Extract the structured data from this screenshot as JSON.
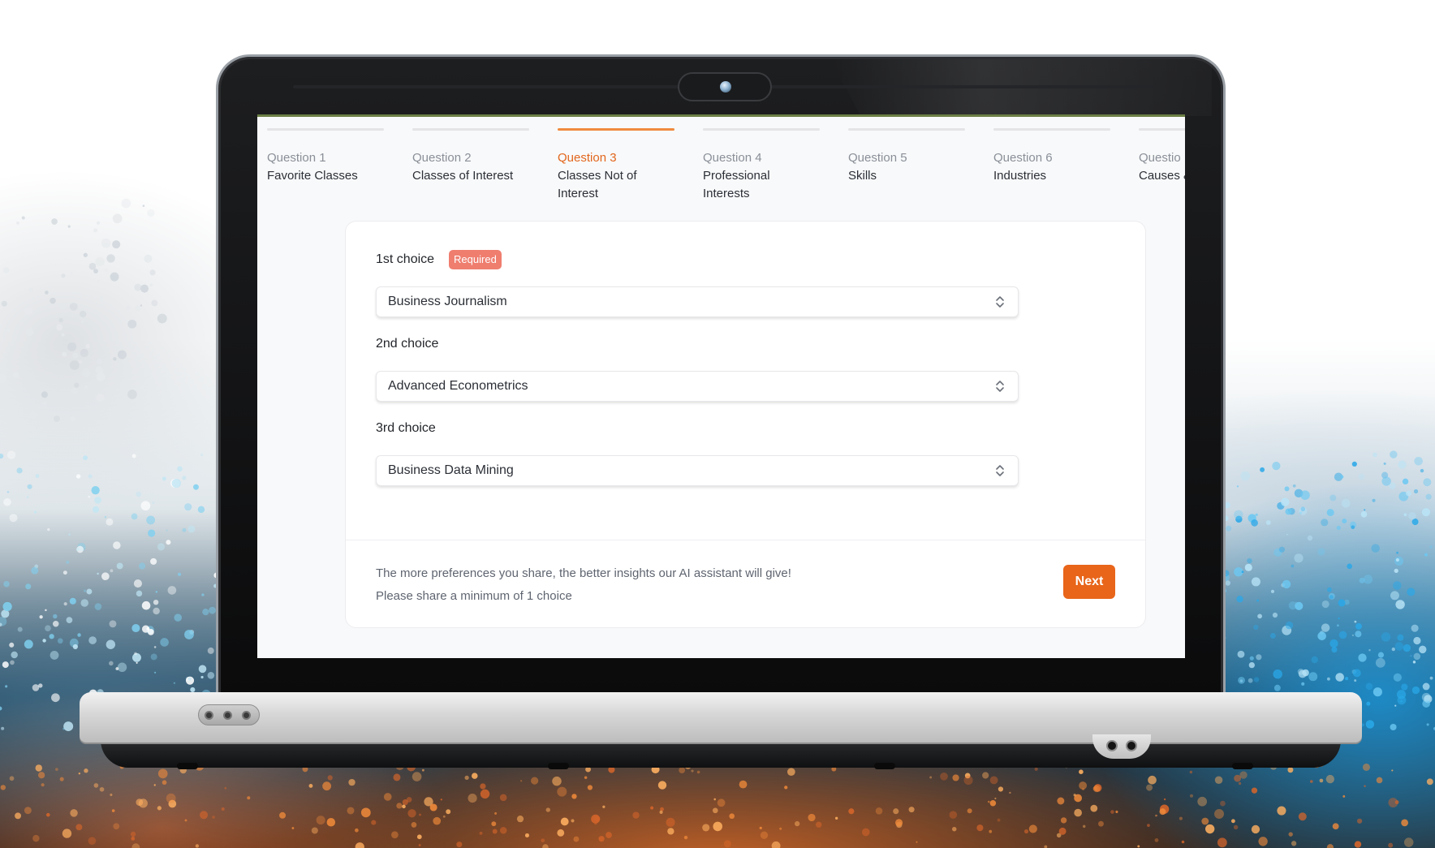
{
  "steps": [
    {
      "number": "Question 1",
      "title": "Favorite Classes"
    },
    {
      "number": "Question 2",
      "title": "Classes of Interest"
    },
    {
      "number": "Question 3",
      "title": "Classes Not of Interest"
    },
    {
      "number": "Question 4",
      "title": "Professional Interests"
    },
    {
      "number": "Question 5",
      "title": "Skills"
    },
    {
      "number": "Question 6",
      "title": "Industries"
    },
    {
      "number": "Questio",
      "title": "Causes &"
    }
  ],
  "form": {
    "choices": [
      {
        "label": "1st choice",
        "badge": "Required",
        "value": "Business Journalism"
      },
      {
        "label": "2nd choice",
        "value": "Advanced Econometrics"
      },
      {
        "label": "3rd choice",
        "value": "Business Data Mining"
      }
    ],
    "footer": {
      "hint_line1": "The more preferences you share, the better insights our AI assistant will give!",
      "hint_line2": "Please share a minimum of 1 choice",
      "next_label": "Next"
    }
  },
  "colors": {
    "accent": "#e8651a",
    "active_step": "#e2661d",
    "required_badge": "#ef7e6f"
  }
}
